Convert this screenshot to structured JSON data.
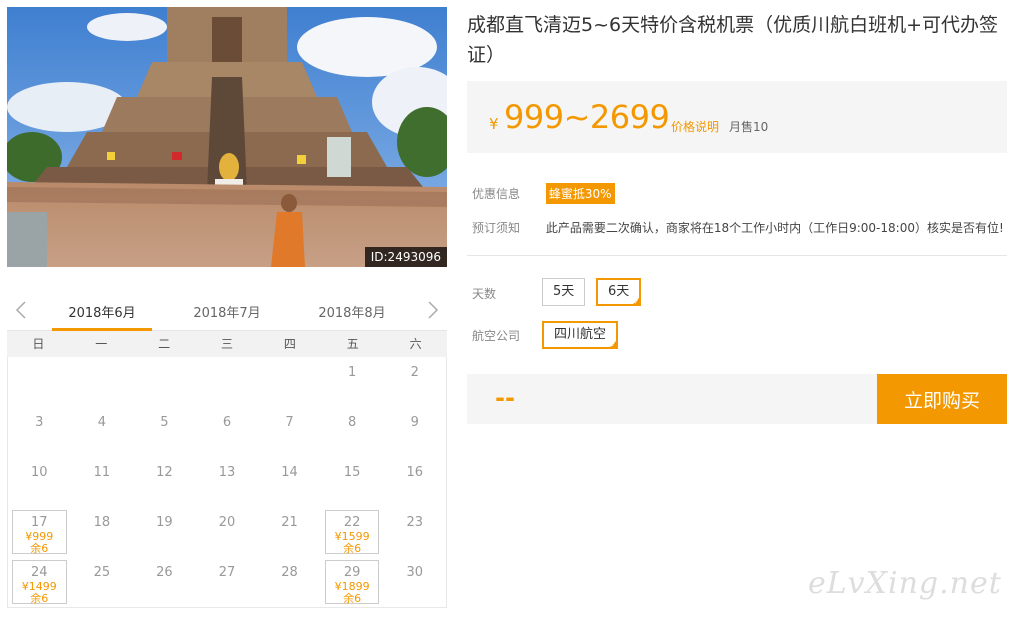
{
  "photo": {
    "id_label": "ID:2493096"
  },
  "calendar": {
    "months": [
      "2018年6月",
      "2018年7月",
      "2018年8月"
    ],
    "weekdays": [
      "日",
      "一",
      "二",
      "三",
      "四",
      "五",
      "六"
    ],
    "leading_blanks": 5,
    "days": [
      {
        "d": "1"
      },
      {
        "d": "2"
      },
      {
        "d": "3"
      },
      {
        "d": "4"
      },
      {
        "d": "5"
      },
      {
        "d": "6"
      },
      {
        "d": "7"
      },
      {
        "d": "8"
      },
      {
        "d": "9"
      },
      {
        "d": "10"
      },
      {
        "d": "11"
      },
      {
        "d": "12"
      },
      {
        "d": "13"
      },
      {
        "d": "14"
      },
      {
        "d": "15"
      },
      {
        "d": "16"
      },
      {
        "d": "17",
        "price": "¥999",
        "stock": "余6"
      },
      {
        "d": "18"
      },
      {
        "d": "19"
      },
      {
        "d": "20"
      },
      {
        "d": "21"
      },
      {
        "d": "22",
        "price": "¥1599",
        "stock": "余6"
      },
      {
        "d": "23"
      },
      {
        "d": "24",
        "price": "¥1499",
        "stock": "余6"
      },
      {
        "d": "25"
      },
      {
        "d": "26"
      },
      {
        "d": "27"
      },
      {
        "d": "28"
      },
      {
        "d": "29",
        "price": "¥1899",
        "stock": "余6"
      },
      {
        "d": "30"
      }
    ]
  },
  "product": {
    "title": "成都直飞清迈5~6天特价含税机票（优质川航白班机+可代办签证）",
    "currency": "¥",
    "price_range": "999~2699",
    "price_note": "价格说明",
    "sold": "月售10"
  },
  "info": {
    "discount_label": "优惠信息",
    "discount_badge": "蜂蜜抵30%",
    "booking_label": "预订须知",
    "booking_text": "此产品需要二次确认，商家将在18个工作小时内（工作日9:00-18:00）核实是否有位!"
  },
  "options": {
    "days_label": "天数",
    "days": [
      "5天",
      "6天"
    ],
    "airline_label": "航空公司",
    "airline": "四川航空"
  },
  "purchase": {
    "total": "--",
    "buy_label": "立即购买"
  },
  "watermark": "eLvXing.net",
  "colors": {
    "accent": "#f39800"
  }
}
